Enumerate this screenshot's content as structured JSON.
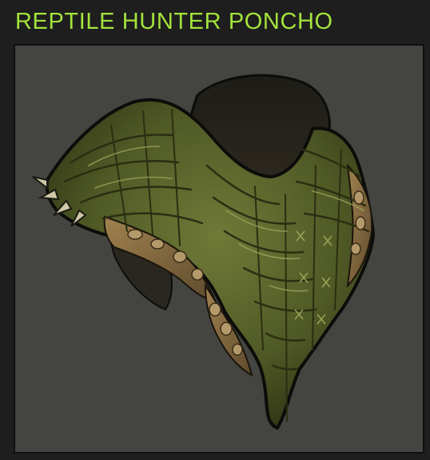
{
  "item": {
    "title": "REPTILE HUNTER PONCHO",
    "image_label": "",
    "image_icon": "reptile-poncho-image"
  },
  "colors": {
    "title": "#a4e33c",
    "page_background": "#1e1e1e",
    "preview_background": "#444441",
    "frame_border": "#0f0f0f",
    "scale_dark": "#2e3314",
    "scale_mid": "#56602a",
    "scale_light": "#8f9a55",
    "underside": "#8d6e45"
  }
}
